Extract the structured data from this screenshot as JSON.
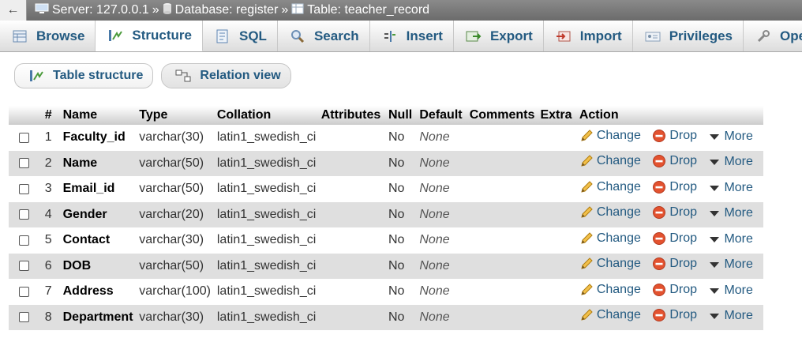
{
  "breadcrumb": {
    "back_icon": "back-arrow-icon",
    "server_label": "Server: 127.0.0.1",
    "database_label": "Database: register",
    "table_label": "Table: teacher_record",
    "separator": "»"
  },
  "tabs": [
    {
      "label": "Browse",
      "icon": "browse-icon",
      "active": false
    },
    {
      "label": "Structure",
      "icon": "structure-icon",
      "active": true
    },
    {
      "label": "SQL",
      "icon": "sql-icon",
      "active": false
    },
    {
      "label": "Search",
      "icon": "search-icon",
      "active": false
    },
    {
      "label": "Insert",
      "icon": "insert-icon",
      "active": false
    },
    {
      "label": "Export",
      "icon": "export-icon",
      "active": false
    },
    {
      "label": "Import",
      "icon": "import-icon",
      "active": false
    },
    {
      "label": "Privileges",
      "icon": "privileges-icon",
      "active": false
    },
    {
      "label": "Operations",
      "icon": "operations-icon",
      "active": false
    }
  ],
  "subtabs": {
    "table_structure": "Table structure",
    "relation_view": "Relation view"
  },
  "table": {
    "headers": {
      "num": "#",
      "name": "Name",
      "type": "Type",
      "collation": "Collation",
      "attributes": "Attributes",
      "null": "Null",
      "default": "Default",
      "comments": "Comments",
      "extra": "Extra",
      "action": "Action"
    },
    "actions": {
      "change": "Change",
      "drop": "Drop",
      "more": "More"
    },
    "rows": [
      {
        "num": "1",
        "name": "Faculty_id",
        "type": "varchar(30)",
        "collation": "latin1_swedish_ci",
        "null": "No",
        "default": "None"
      },
      {
        "num": "2",
        "name": "Name",
        "type": "varchar(50)",
        "collation": "latin1_swedish_ci",
        "null": "No",
        "default": "None"
      },
      {
        "num": "3",
        "name": "Email_id",
        "type": "varchar(50)",
        "collation": "latin1_swedish_ci",
        "null": "No",
        "default": "None"
      },
      {
        "num": "4",
        "name": "Gender",
        "type": "varchar(20)",
        "collation": "latin1_swedish_ci",
        "null": "No",
        "default": "None"
      },
      {
        "num": "5",
        "name": "Contact",
        "type": "varchar(30)",
        "collation": "latin1_swedish_ci",
        "null": "No",
        "default": "None"
      },
      {
        "num": "6",
        "name": "DOB",
        "type": "varchar(50)",
        "collation": "latin1_swedish_ci",
        "null": "No",
        "default": "None"
      },
      {
        "num": "7",
        "name": "Address",
        "type": "varchar(100)",
        "collation": "latin1_swedish_ci",
        "null": "No",
        "default": "None"
      },
      {
        "num": "8",
        "name": "Department",
        "type": "varchar(30)",
        "collation": "latin1_swedish_ci",
        "null": "No",
        "default": "None"
      }
    ]
  },
  "colors": {
    "link": "#235a81",
    "row_alt": "#dfdfdf",
    "drop_red": "#d9412c",
    "pencil": "#e3a21a"
  }
}
